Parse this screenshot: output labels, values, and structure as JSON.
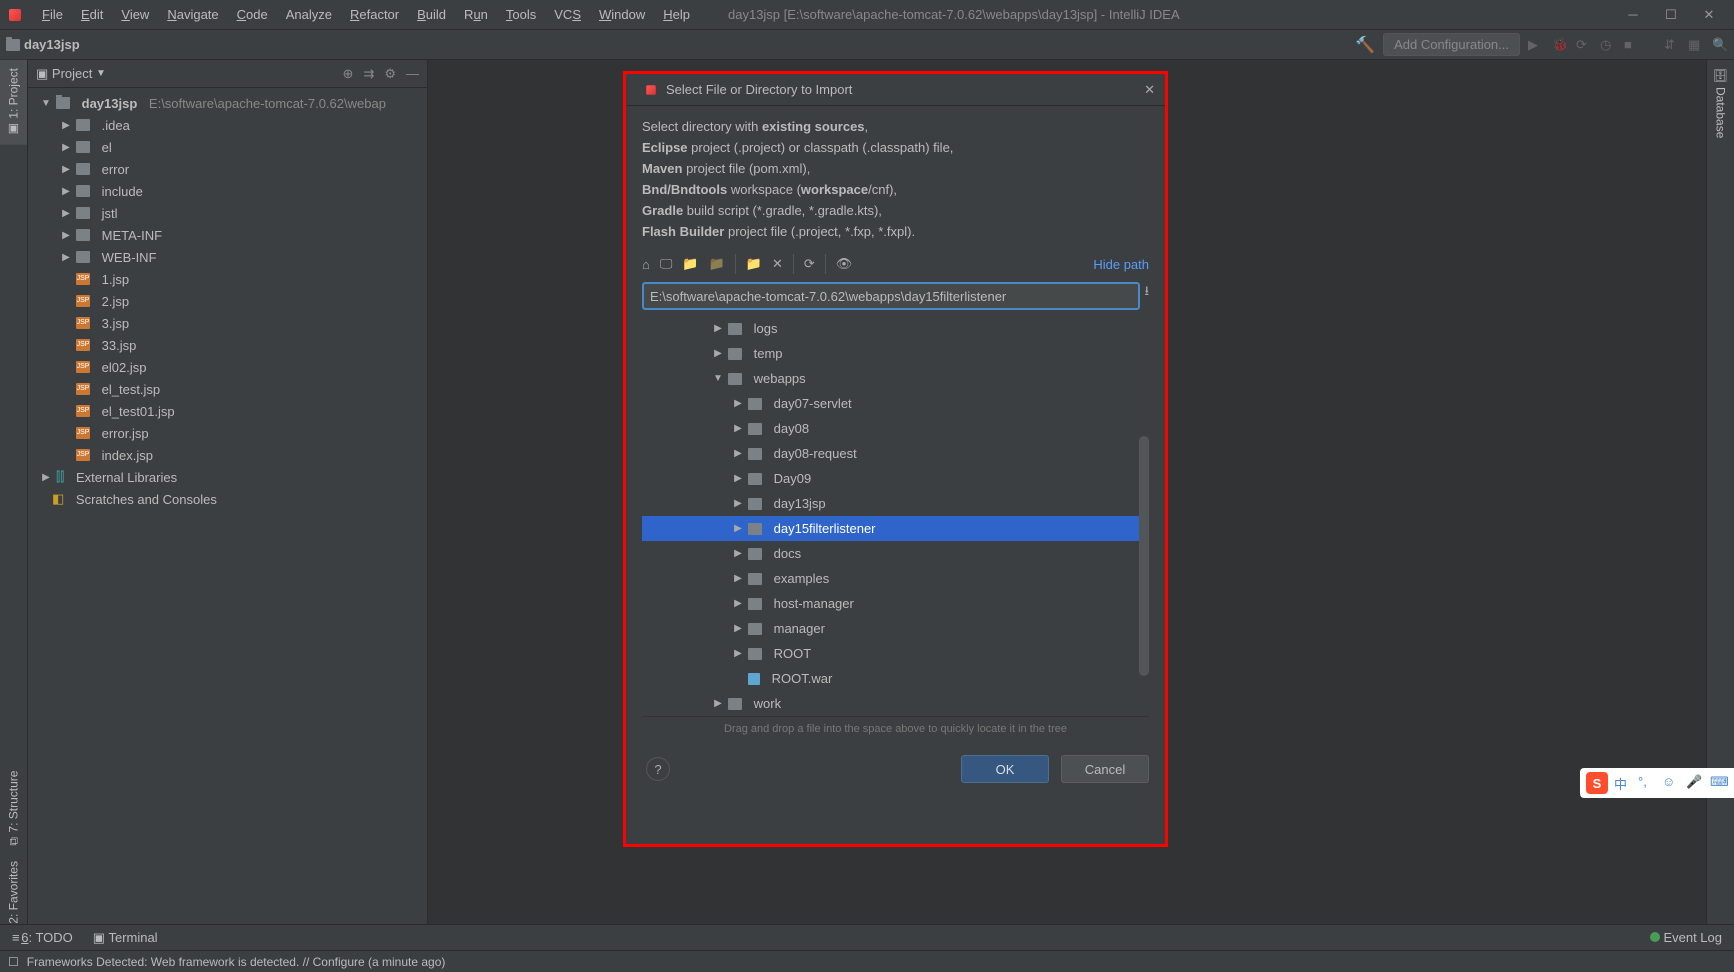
{
  "titlebar": {
    "title": "day13jsp [E:\\software\\apache-tomcat-7.0.62\\webapps\\day13jsp] - IntelliJ IDEA"
  },
  "menus": {
    "file": "File",
    "edit": "Edit",
    "view": "View",
    "navigate": "Navigate",
    "code": "Code",
    "analyze": "Analyze",
    "refactor": "Refactor",
    "build": "Build",
    "run": "Run",
    "tools": "Tools",
    "vcs": "VCS",
    "window": "Window",
    "help": "Help"
  },
  "nav": {
    "project": "day13jsp",
    "add_config": "Add Configuration..."
  },
  "left_tabs": {
    "project": "1: Project",
    "structure": "7: Structure",
    "favorites": "2: Favorites"
  },
  "right_tabs": {
    "database": "Database"
  },
  "project_panel": {
    "title": "Project",
    "root": "day13jsp",
    "root_path": "E:\\software\\apache-tomcat-7.0.62\\webap",
    "folders": [
      ".idea",
      "el",
      "error",
      "include",
      "jstl",
      "META-INF",
      "WEB-INF"
    ],
    "jsps": [
      "1.jsp",
      "2.jsp",
      "3.jsp",
      "33.jsp",
      "el02.jsp",
      "el_test.jsp",
      "el_test01.jsp",
      "error.jsp",
      "index.jsp"
    ],
    "external": "External Libraries",
    "scratches": "Scratches and Consoles"
  },
  "dialog": {
    "title": "Select File or Directory to Import",
    "desc_line1_pre": "Select directory with ",
    "desc_line1_b": "existing sources",
    "desc_line1_post": ",",
    "desc_line2_b": "Eclipse",
    "desc_line2_post": " project (.project) or classpath (.classpath) file,",
    "desc_line3_b": "Maven",
    "desc_line3_post": " project file (pom.xml),",
    "desc_line4_b": "Bnd/Bndtools",
    "desc_line4_mid": " workspace (",
    "desc_line4_b2": "workspace",
    "desc_line4_post": "/cnf),",
    "desc_line5_b": "Gradle",
    "desc_line5_post": " build script (*.gradle, *.gradle.kts),",
    "desc_line6_b": "Flash Builder",
    "desc_line6_post": " project file (.project, *.fxp, *.fxpl).",
    "hide_path": "Hide path",
    "path": "E:\\software\\apache-tomcat-7.0.62\\webapps\\day15filterlistener",
    "tree": [
      "logs",
      "temp",
      "webapps"
    ],
    "webapps_items": [
      "day07-servlet",
      "day08",
      "day08-request",
      "Day09",
      "day13jsp",
      "day15filterlistener",
      "docs",
      "examples",
      "host-manager",
      "manager",
      "ROOT"
    ],
    "root_war": "ROOT.war",
    "work": "work",
    "hint": "Drag and drop a file into the space above to quickly locate it in the tree",
    "ok": "OK",
    "cancel": "Cancel"
  },
  "bottom": {
    "todo": "6: TODO",
    "terminal": "Terminal",
    "event_log": "Event Log",
    "status": "Frameworks Detected: Web framework is detected. // Configure (a minute ago)"
  }
}
